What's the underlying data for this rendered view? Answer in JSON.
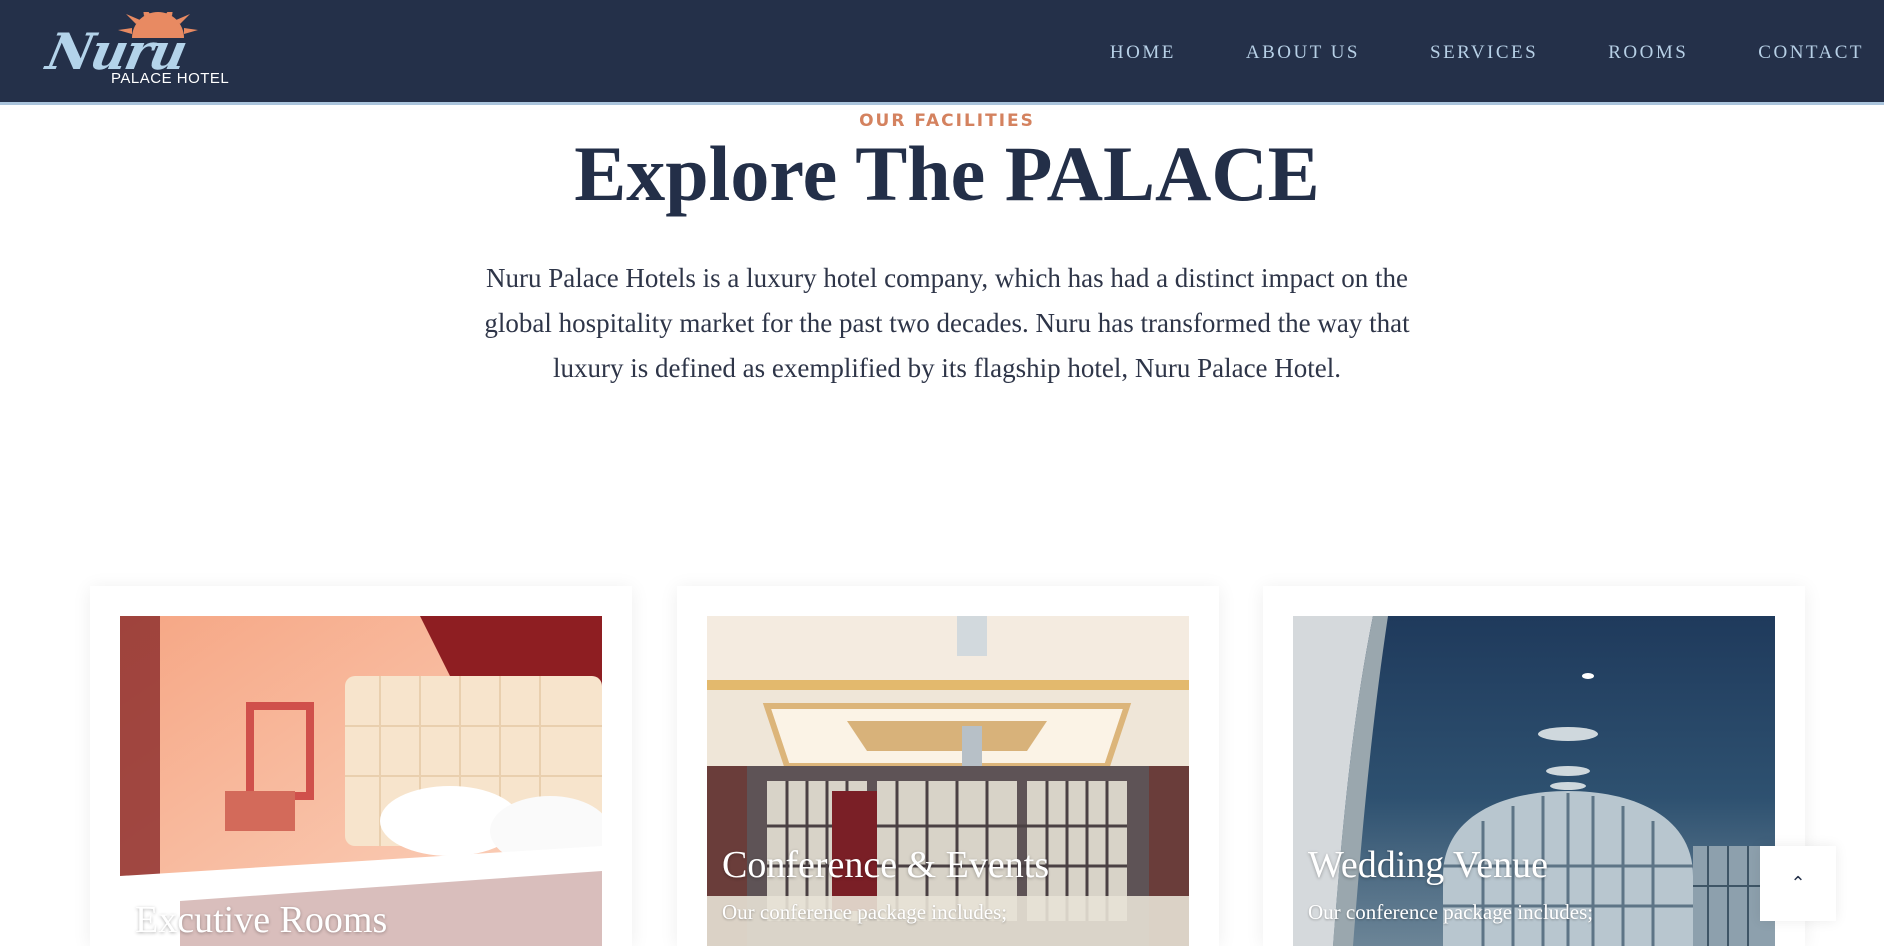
{
  "brand": {
    "script": "Nuru",
    "sub": "PALACE HOTEL"
  },
  "nav": {
    "items": [
      {
        "label": "HOME"
      },
      {
        "label": "ABOUT US"
      },
      {
        "label": "SERVICES"
      },
      {
        "label": "ROOMS"
      },
      {
        "label": "CONTACT"
      }
    ]
  },
  "intro": {
    "kicker": "OUR FACILITIES",
    "title": "Explore The PALACE",
    "description": "Nuru Palace Hotels is a luxury hotel company, which has had a distinct impact on the global hospitality market for the past two decades. Nuru has transformed the way that luxury is defined as exemplified by its flagship hotel, Nuru Palace Hotel."
  },
  "cards": [
    {
      "title": "Excutive Rooms",
      "text": ""
    },
    {
      "title": "Conference & Events",
      "text": "Our conference package includes;"
    },
    {
      "title": "Wedding Venue",
      "text": "Our conference package includes;"
    }
  ],
  "scroll_top": {
    "icon": "chevron-up-icon",
    "glyph": "⌃"
  },
  "colors": {
    "header_bg": "#243049",
    "nav_text": "#b7d0e6",
    "accent": "#d4825f",
    "heading": "#232f48"
  }
}
